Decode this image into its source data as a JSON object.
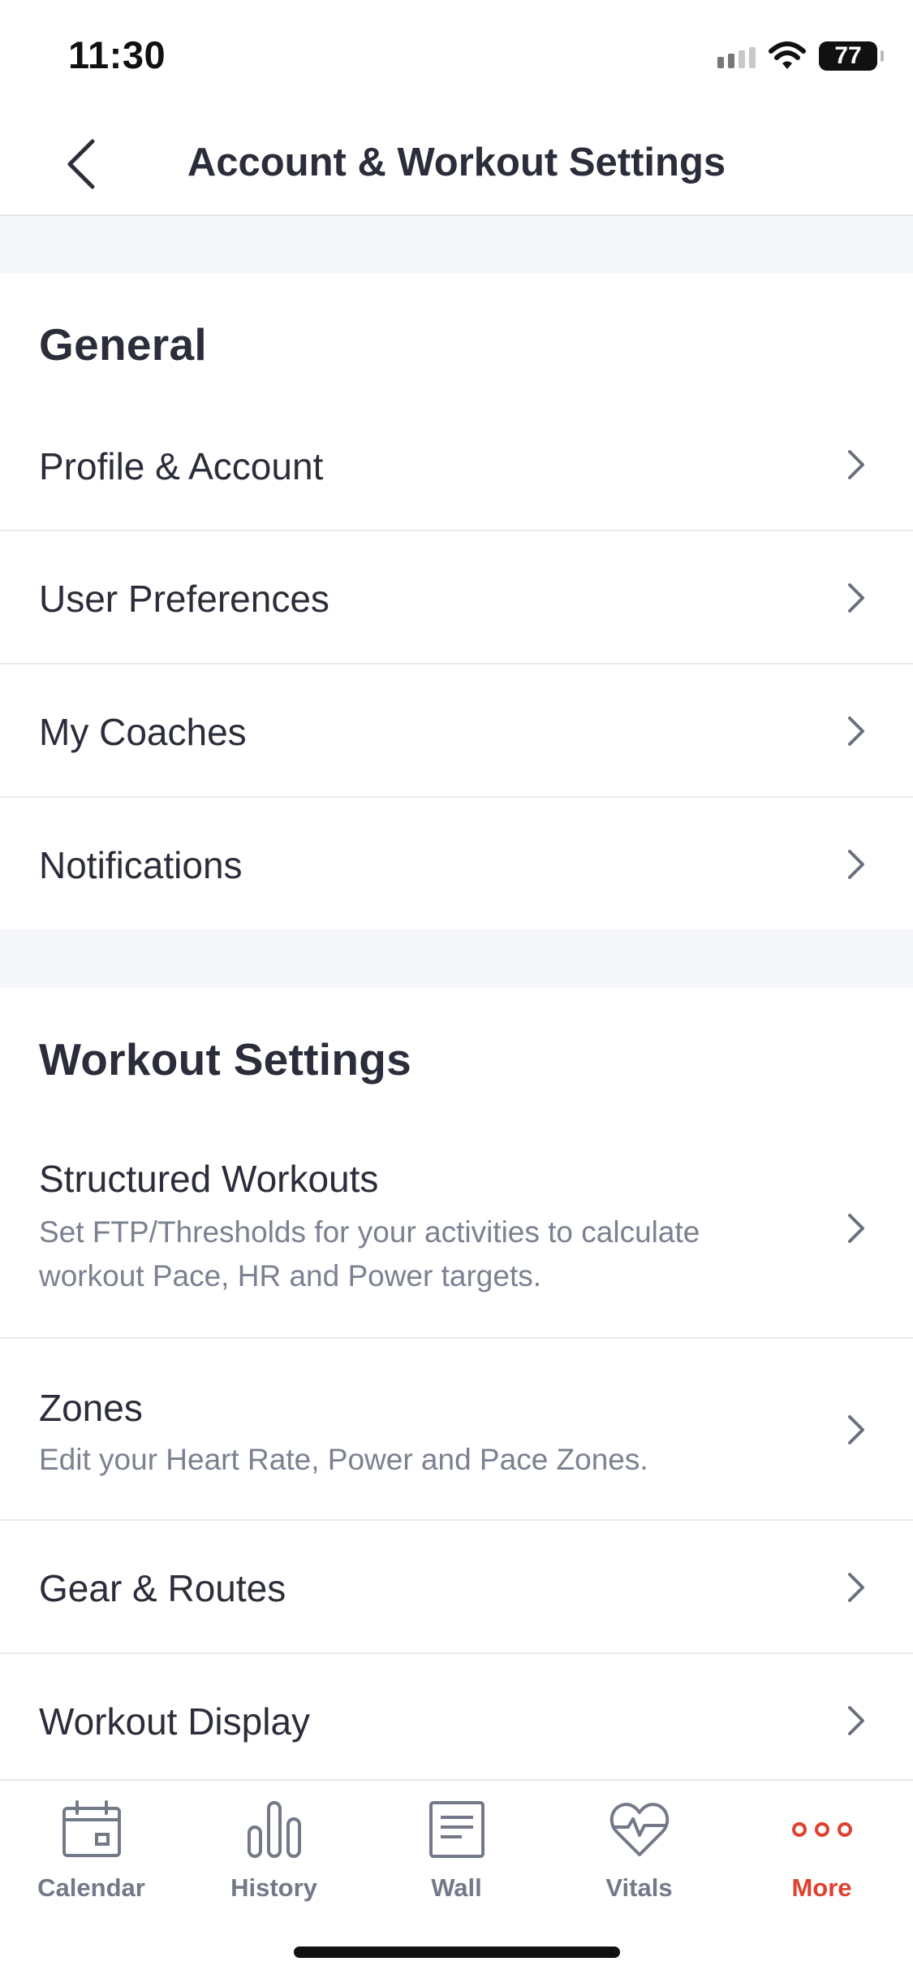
{
  "status_bar": {
    "time": "11:30",
    "battery": "77"
  },
  "header": {
    "title": "Account & Workout Settings",
    "back_icon": "chevron-left-icon"
  },
  "sections": {
    "general": {
      "title": "General",
      "items": [
        {
          "label": "Profile & Account"
        },
        {
          "label": "User Preferences"
        },
        {
          "label": "My Coaches"
        },
        {
          "label": "Notifications"
        }
      ]
    },
    "workout": {
      "title": "Workout Settings",
      "items": [
        {
          "label": "Structured Workouts",
          "subtitle": "Set FTP/Thresholds for your activities to calculate workout Pace, HR and Power targets."
        },
        {
          "label": "Zones",
          "subtitle": "Edit your Heart Rate, Power and Pace Zones."
        },
        {
          "label": "Gear & Routes"
        },
        {
          "label": "Workout Display"
        }
      ]
    }
  },
  "tab_bar": {
    "tabs": [
      {
        "label": "Calendar",
        "icon": "calendar-icon"
      },
      {
        "label": "History",
        "icon": "bar-chart-icon"
      },
      {
        "label": "Wall",
        "icon": "wall-icon"
      },
      {
        "label": "Vitals",
        "icon": "heart-pulse-icon"
      },
      {
        "label": "More",
        "icon": "more-dots-icon",
        "active": true
      }
    ]
  },
  "colors": {
    "accent": "#e0402f",
    "text": "#2b2d3a",
    "muted": "#7b8190",
    "divider": "#e9ebef",
    "background_gap": "#f5f7fa"
  }
}
